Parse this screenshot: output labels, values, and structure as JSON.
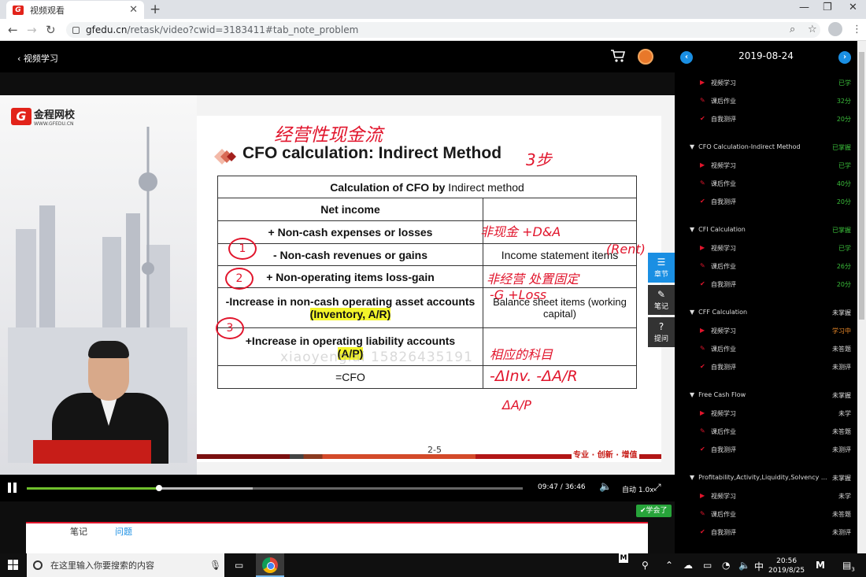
{
  "browser": {
    "tab_title": "视频观看",
    "favicon_text": "G",
    "tab_close": "✕",
    "new_tab": "+",
    "url_domain": "gfedu.cn",
    "url_path": "/retask/video?cwid=3183411#tab_note_problem"
  },
  "header": {
    "back_label": "视频学习"
  },
  "slide": {
    "logo_mark": "G",
    "logo_name": "金程网校",
    "logo_site": "WWW.GFEDU.CN",
    "title": "CFO calculation: Indirect Method",
    "handwriting_top": "经营性现金流",
    "handwriting_side": "3步",
    "table_header_left": "Calculation of CFO by",
    "table_header_right": " Indirect method",
    "rows": [
      {
        "left": "Net income",
        "right": ""
      },
      {
        "left": "+ Non-cash expenses or losses",
        "right": ""
      },
      {
        "left": "- Non-cash revenues or gains",
        "right": "Income statement items"
      },
      {
        "left": "+ Non-operating items loss-gain",
        "right": ""
      },
      {
        "left_a": "-Increase in non-cash operating asset accounts",
        "left_hl": "(Inventory, A/R)",
        "right": "Balance sheet items (working capital)"
      },
      {
        "left_a": "+Increase in operating liability accounts",
        "left_hl": "(A/P)",
        "right": ""
      },
      {
        "left": "=CFO",
        "right": ""
      }
    ],
    "annotations": {
      "a1": "非现金 +D&A",
      "a2": "(Rent)",
      "a3": "非经营 处置固定",
      "a4": "-G +Loss",
      "a5": "相应的科目",
      "a6": "-ΔInv. -ΔA/R",
      "a7": "ΔA/P",
      "c1": "1",
      "c2": "2",
      "c3": "3"
    },
    "watermark": "xiaoyenglai 15826435191",
    "page": "2-5",
    "slogan": "专业 · 创新 · 增值"
  },
  "side_tools": [
    {
      "icon": "☰",
      "label": "章节"
    },
    {
      "icon": "✎",
      "label": "笔记"
    },
    {
      "icon": "?",
      "label": "提问"
    }
  ],
  "player": {
    "current_time": "09:47",
    "duration": "36:46",
    "time_sep": " / ",
    "speed": "自动 1.0x",
    "progress": 0.266,
    "buffered": 0.455,
    "learned_label": "✔学会了"
  },
  "notes": {
    "tab_notes": "笔记",
    "tab_questions": "问题"
  },
  "panel": {
    "date": "2019-08-24",
    "prev": "‹",
    "next": "›"
  },
  "course": [
    {
      "kind": "item",
      "icon": "video",
      "label": "视频学习",
      "status": "已学",
      "color": "g"
    },
    {
      "kind": "item",
      "icon": "homework",
      "label": "课后作业",
      "status": "32分",
      "color": "g"
    },
    {
      "kind": "item",
      "icon": "test",
      "label": "自我测评",
      "status": "20分",
      "color": "g"
    },
    {
      "kind": "section",
      "label": "CFO Calculation-Indirect Method",
      "status": "已掌握",
      "color": "g"
    },
    {
      "kind": "item",
      "icon": "video",
      "label": "视频学习",
      "status": "已学",
      "color": "g"
    },
    {
      "kind": "item",
      "icon": "homework",
      "label": "课后作业",
      "status": "40分",
      "color": "g"
    },
    {
      "kind": "item",
      "icon": "test",
      "label": "自我测评",
      "status": "20分",
      "color": "g"
    },
    {
      "kind": "section",
      "label": "CFI Calculation",
      "status": "已掌握",
      "color": "g"
    },
    {
      "kind": "item",
      "icon": "video",
      "label": "视频学习",
      "status": "已学",
      "color": "g"
    },
    {
      "kind": "item",
      "icon": "homework",
      "label": "课后作业",
      "status": "26分",
      "color": "g"
    },
    {
      "kind": "item",
      "icon": "test",
      "label": "自我测评",
      "status": "20分",
      "color": "g"
    },
    {
      "kind": "section",
      "label": "CFF Calculation",
      "status": "未掌握",
      "color": "w"
    },
    {
      "kind": "item",
      "icon": "video",
      "label": "视频学习",
      "status": "学习中",
      "color": "o"
    },
    {
      "kind": "item",
      "icon": "homework",
      "label": "课后作业",
      "status": "未答题",
      "color": "w"
    },
    {
      "kind": "item",
      "icon": "test",
      "label": "自我测评",
      "status": "未测评",
      "color": "w"
    },
    {
      "kind": "section",
      "label": "Free Cash Flow",
      "status": "未掌握",
      "color": "w"
    },
    {
      "kind": "item",
      "icon": "video",
      "label": "视频学习",
      "status": "未学",
      "color": "w"
    },
    {
      "kind": "item",
      "icon": "homework",
      "label": "课后作业",
      "status": "未答题",
      "color": "w"
    },
    {
      "kind": "item",
      "icon": "test",
      "label": "自我测评",
      "status": "未测评",
      "color": "w"
    },
    {
      "kind": "section",
      "label": "Profitability,Activity,Liquidity,Solvency ...",
      "status": "未掌握",
      "color": "w"
    },
    {
      "kind": "item",
      "icon": "video",
      "label": "视频学习",
      "status": "未学",
      "color": "w"
    },
    {
      "kind": "item",
      "icon": "homework",
      "label": "课后作业",
      "status": "未答题",
      "color": "w"
    },
    {
      "kind": "item",
      "icon": "test",
      "label": "自我测评",
      "status": "未测评",
      "color": "w"
    }
  ],
  "taskbar": {
    "search_placeholder": "在这里输入你要搜索的内容",
    "m_label": "M",
    "time": "20:56",
    "date": "2019/8/25",
    "ime": "中",
    "notif_count": "3"
  },
  "colors": {
    "accent": "#1a8fe3",
    "brand_red": "#e2231a",
    "green": "#3bbf3b",
    "orange": "#f08c2a"
  }
}
